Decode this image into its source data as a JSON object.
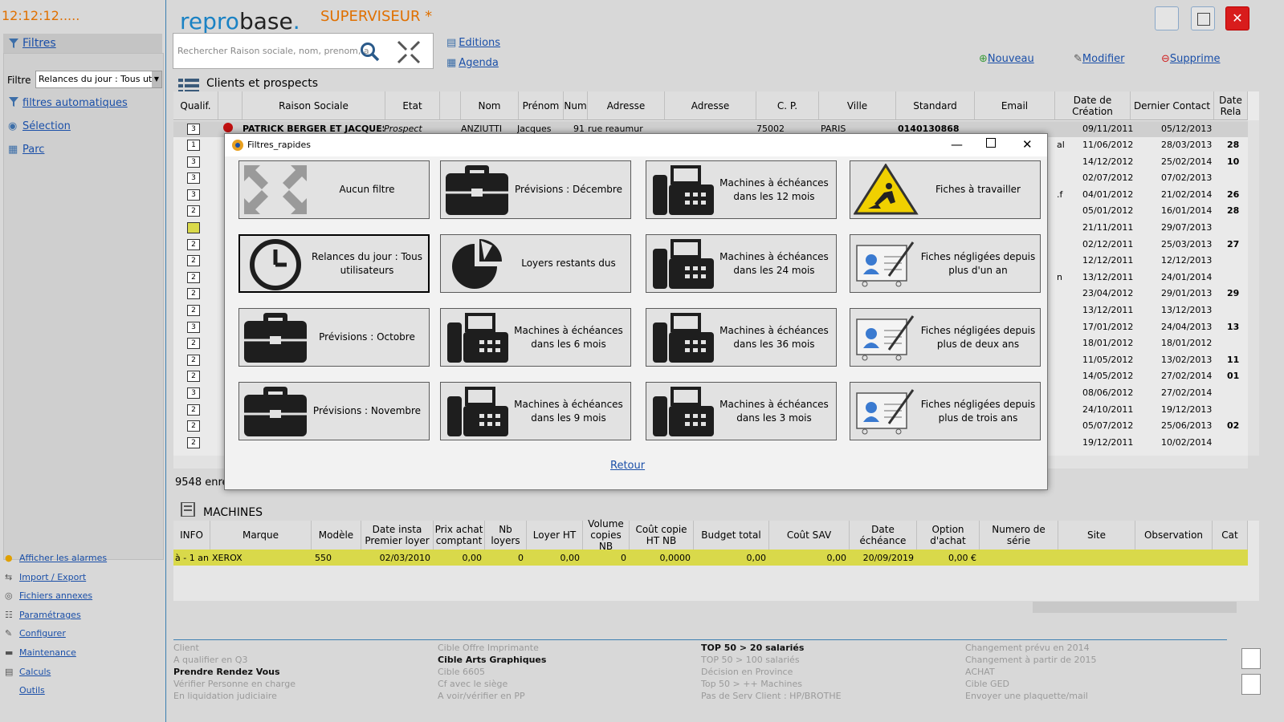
{
  "clock": "12:12:12.....",
  "app": {
    "logo_a": "repro",
    "logo_b": "base",
    "logo_c": ".",
    "user_role": "SUPERVISEUR *"
  },
  "left": {
    "filtres": "Filtres",
    "filtre_label": "Filtre",
    "filtre_value": "Relances du jour :  Tous utilis",
    "nav": [
      "filtres automatiques",
      "Sélection",
      "Parc"
    ],
    "bottom_links": [
      "Afficher les alarmes",
      "Import / Export",
      "Fichiers annexes",
      "Paramétrages",
      "Configurer",
      "Maintenance",
      "Calculs",
      "Outils"
    ]
  },
  "search": {
    "placeholder": "Rechercher Raison sociale, nom, prenom, a"
  },
  "links": {
    "editions": "Editions",
    "agenda": "Agenda"
  },
  "toolbar": {
    "nouveau": "Nouveau",
    "modifier": "Modifier",
    "supprime": "Supprime"
  },
  "window": {
    "close": "✕"
  },
  "clients": {
    "title": "Clients et prospects",
    "columns": [
      "Qualif.",
      "",
      "Raison Sociale",
      "Etat",
      "",
      "Nom",
      "Prénom",
      "Num",
      "Adresse",
      "Adresse",
      "C. P.",
      "Ville",
      "Standard",
      "Email",
      "Date de Création",
      "Dernier Contact",
      "Date Rela"
    ],
    "first_row": [
      "3",
      "",
      "PATRICK BERGER ET JACQUES ANZI",
      "Prospect",
      "",
      "ANZIUTTI",
      "Jacques",
      "91",
      "rue reaumur",
      "",
      "75002",
      "PARIS",
      "0140130868",
      "",
      "09/11/2011",
      "05/12/2013",
      ""
    ],
    "rows": [
      {
        "q": "1",
        "right": "al",
        "dc": "11/06/2012",
        "lc": "28/03/2013",
        "rel": "28"
      },
      {
        "q": "3",
        "right": "",
        "dc": "14/12/2012",
        "lc": "25/02/2014",
        "rel": "10"
      },
      {
        "q": "3",
        "right": "",
        "dc": "02/07/2012",
        "lc": "07/02/2013",
        "rel": ""
      },
      {
        "q": "3",
        "right": ".f",
        "dc": "04/01/2012",
        "lc": "21/02/2014",
        "rel": "26"
      },
      {
        "q": "2",
        "right": "",
        "dc": "05/01/2012",
        "lc": "16/01/2014",
        "rel": "28"
      },
      {
        "q": "",
        "right": "",
        "dc": "21/11/2011",
        "lc": "29/07/2013",
        "rel": ""
      },
      {
        "q": "2",
        "right": "",
        "dc": "02/12/2011",
        "lc": "25/03/2013",
        "rel": "27"
      },
      {
        "q": "2",
        "right": "",
        "dc": "12/12/2011",
        "lc": "12/12/2013",
        "rel": ""
      },
      {
        "q": "2",
        "right": "n",
        "dc": "13/12/2011",
        "lc": "24/01/2014",
        "rel": ""
      },
      {
        "q": "2",
        "right": "",
        "dc": "23/04/2012",
        "lc": "29/01/2013",
        "rel": "29"
      },
      {
        "q": "2",
        "right": "",
        "dc": "13/12/2011",
        "lc": "13/12/2013",
        "rel": ""
      },
      {
        "q": "3",
        "right": "",
        "dc": "17/01/2012",
        "lc": "24/04/2013",
        "rel": "13"
      },
      {
        "q": "2",
        "right": "",
        "dc": "18/01/2012",
        "lc": "18/01/2012",
        "rel": ""
      },
      {
        "q": "2",
        "right": "",
        "dc": "11/05/2012",
        "lc": "13/02/2013",
        "rel": "11"
      },
      {
        "q": "2",
        "right": "",
        "dc": "14/05/2012",
        "lc": "27/02/2014",
        "rel": "01"
      },
      {
        "q": "3",
        "right": "",
        "dc": "08/06/2012",
        "lc": "27/02/2014",
        "rel": ""
      },
      {
        "q": "2",
        "right": "",
        "dc": "24/10/2011",
        "lc": "19/12/2013",
        "rel": ""
      },
      {
        "q": "2",
        "right": "",
        "dc": "05/07/2012",
        "lc": "25/06/2013",
        "rel": "02"
      },
      {
        "q": "2",
        "right": "",
        "dc": "19/12/2011",
        "lc": "10/02/2014",
        "rel": ""
      }
    ],
    "count": "9548 enre"
  },
  "machines": {
    "title": "MACHINES",
    "columns": [
      "INFO",
      "Marque",
      "Modèle",
      "Date insta Premier loyer",
      "Prix achat comptant",
      "Nb loyers",
      "Loyer HT",
      "Volume copies NB",
      "Coût copie HT NB",
      "Budget total",
      "Coût SAV",
      "Date échéance",
      "Option d'achat",
      "Numero de série",
      "Site",
      "Observation",
      "Cat"
    ],
    "row": [
      "à - 1 an",
      "XEROX",
      "550",
      "02/03/2010",
      "0,00",
      "0",
      "0,00",
      "0",
      "0,0000",
      "0,00",
      "0,00",
      "20/09/2019",
      "0,00 €",
      "",
      "",
      "",
      ""
    ]
  },
  "bottom_list": [
    [
      {
        "t": "Client",
        "b": false
      },
      {
        "t": "A qualifier en Q3",
        "b": false
      },
      {
        "t": "Prendre Rendez Vous",
        "b": true
      },
      {
        "t": "Vérifier Personne en charge",
        "b": false
      },
      {
        "t": "En liquidation judiciaire",
        "b": false
      }
    ],
    [
      {
        "t": "Cible Offre Imprimante",
        "b": false
      },
      {
        "t": "Cible Arts Graphiques",
        "b": true
      },
      {
        "t": "Cible 6605",
        "b": false
      },
      {
        "t": "Cf avec le siège",
        "b": false
      },
      {
        "t": "A voir/vérifier en PP",
        "b": false
      }
    ],
    [
      {
        "t": "TOP 50 > 20 salariés",
        "b": true
      },
      {
        "t": "TOP 50 > 100 salariés",
        "b": false
      },
      {
        "t": "Décision en Province",
        "b": false
      },
      {
        "t": "Top 50 > ++ Machines",
        "b": false
      },
      {
        "t": "Pas de Serv Client : HP/BROTHE",
        "b": false
      }
    ],
    [
      {
        "t": "Changement prévu en 2014",
        "b": false
      },
      {
        "t": "Changement à partir de 2015",
        "b": false
      },
      {
        "t": "ACHAT",
        "b": false
      },
      {
        "t": "Cible GED",
        "b": false
      },
      {
        "t": "Envoyer une plaquette/mail",
        "b": false
      }
    ]
  ],
  "dialog": {
    "title": "Filtres_rapides",
    "retour": "Retour",
    "tiles": [
      {
        "label": "Aucun filtre",
        "icon": "arrows-collapse-icon"
      },
      {
        "label": "Prévisions : Décembre",
        "icon": "briefcase-icon"
      },
      {
        "label": "Machines à échéances dans les 12 mois",
        "icon": "fax-machine-icon"
      },
      {
        "label": "Fiches à travailler",
        "icon": "roadwork-sign-icon"
      },
      {
        "label": "Relances du jour :  Tous utilisateurs",
        "icon": "clock-icon"
      },
      {
        "label": "Loyers restants dus",
        "icon": "pie-chart-icon"
      },
      {
        "label": "Machines à échéances dans les 24 mois",
        "icon": "fax-machine-icon"
      },
      {
        "label": "Fiches négligées depuis plus d'un an",
        "icon": "user-card-icon"
      },
      {
        "label": "Prévisions : Octobre",
        "icon": "briefcase-icon"
      },
      {
        "label": "Machines à échéances dans les 6 mois",
        "icon": "fax-machine-icon"
      },
      {
        "label": "Machines à échéances dans les 36 mois",
        "icon": "fax-machine-icon"
      },
      {
        "label": "Fiches négligées depuis plus de deux ans",
        "icon": "user-card-icon"
      },
      {
        "label": "Prévisions : Novembre",
        "icon": "briefcase-icon"
      },
      {
        "label": "Machines à échéances dans les 9 mois",
        "icon": "fax-machine-icon"
      },
      {
        "label": "Machines à échéances dans les 3 mois",
        "icon": "fax-machine-icon"
      },
      {
        "label": "Fiches négligées depuis plus de trois ans",
        "icon": "user-card-icon"
      }
    ]
  }
}
